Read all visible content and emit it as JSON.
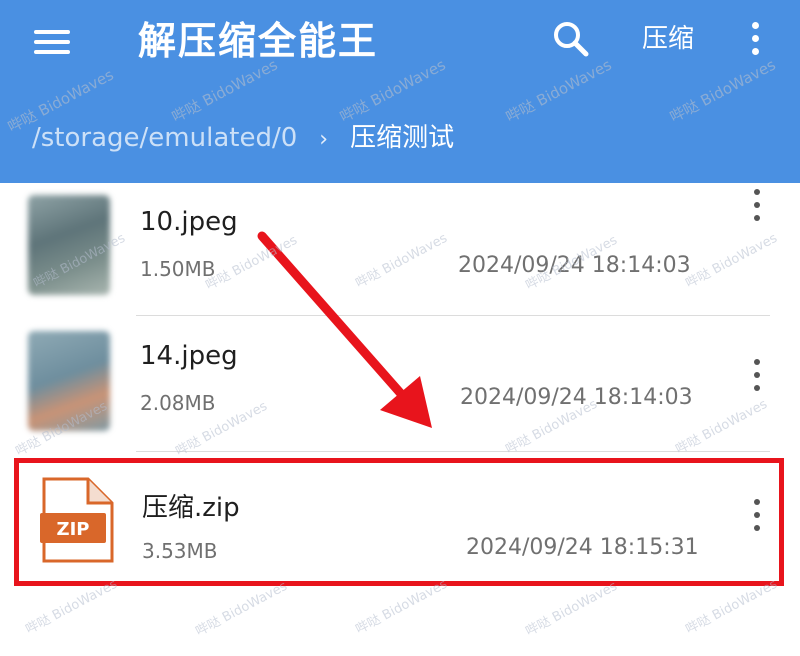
{
  "app": {
    "title": "解压缩全能王",
    "compress_label": "压缩"
  },
  "breadcrumb": {
    "root": "/storage/emulated/0",
    "current": "压缩测试"
  },
  "files": [
    {
      "name": "10.jpeg",
      "size": "1.50MB",
      "date": "2024/09/24 18:14:03",
      "type": "image"
    },
    {
      "name": "14.jpeg",
      "size": "2.08MB",
      "date": "2024/09/24 18:14:03",
      "type": "image"
    },
    {
      "name": "压缩.zip",
      "size": "3.53MB",
      "date": "2024/09/24 18:15:31",
      "type": "zip",
      "icon_label": "ZIP"
    }
  ],
  "watermark": {
    "cn": "哔哒",
    "en": "BidoWaves"
  },
  "colors": {
    "appbar": "#4a90e2",
    "highlight": "#e8141c",
    "zip_orange": "#d9672a"
  },
  "icons": [
    "menu-icon",
    "search-icon",
    "more-vertical-icon",
    "image-thumbnail",
    "zip-file-icon"
  ]
}
